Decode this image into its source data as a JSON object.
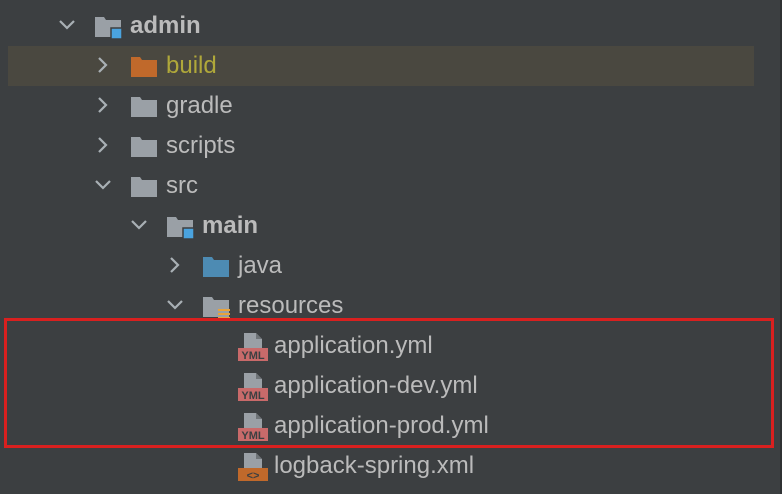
{
  "tree": {
    "items": [
      {
        "label": "admin",
        "kind": "module",
        "expanded": true,
        "bold": true
      },
      {
        "label": "build",
        "kind": "excluded-folder",
        "expanded": false
      },
      {
        "label": "gradle",
        "kind": "folder",
        "expanded": false
      },
      {
        "label": "scripts",
        "kind": "folder",
        "expanded": false
      },
      {
        "label": "src",
        "kind": "folder",
        "expanded": true
      },
      {
        "label": "main",
        "kind": "module-folder",
        "expanded": true,
        "bold": true
      },
      {
        "label": "java",
        "kind": "source-folder",
        "expanded": false
      },
      {
        "label": "resources",
        "kind": "resources-folder",
        "expanded": true
      },
      {
        "label": "application.yml",
        "kind": "yml-file"
      },
      {
        "label": "application-dev.yml",
        "kind": "yml-file"
      },
      {
        "label": "application-prod.yml",
        "kind": "yml-file"
      },
      {
        "label": "logback-spring.xml",
        "kind": "xml-file"
      }
    ]
  },
  "icons": {
    "yml_badge": "YML",
    "xml_badge": "<>"
  },
  "colors": {
    "background": "#3c3f41",
    "text": "#bbbbbb",
    "excluded_text": "#b0a83a",
    "folder": "#9aa0a6",
    "excluded_folder": "#c0692b",
    "source_folder": "#4d8bb3",
    "module_badge": "#4aa3df",
    "highlight_border": "#d9201f"
  }
}
